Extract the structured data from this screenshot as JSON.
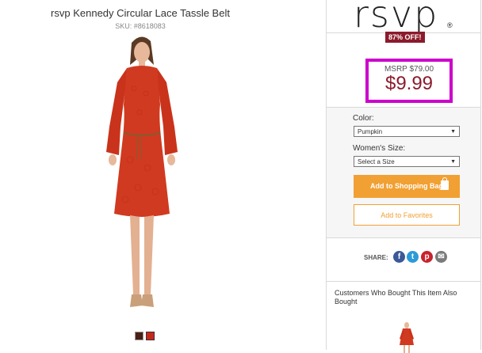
{
  "product": {
    "title": "rsvp Kennedy Circular Lace Tassle Belt",
    "sku": "SKU: #8618083"
  },
  "swatches": [
    {
      "color": "#4a1f14"
    },
    {
      "color": "#c8281c"
    }
  ],
  "brand": {
    "logo_text": "rsvp",
    "registered_mark": "®"
  },
  "pricing": {
    "discount_badge": "87% OFF!",
    "msrp": "MSRP $79.00",
    "price": "$9.99"
  },
  "options": {
    "color_label": "Color:",
    "color_value": "Pumpkin",
    "size_label": "Women's Size:",
    "size_value": "Select a Size"
  },
  "actions": {
    "add_to_bag": "Add to Shopping Bag",
    "add_to_favorites": "Add to Favorites"
  },
  "share": {
    "label": "SHARE:",
    "icons": [
      "facebook-icon",
      "twitter-icon",
      "pinterest-icon",
      "email-icon"
    ]
  },
  "also_bought": {
    "title": "Customers Who Bought This Item Also Bought"
  },
  "colors": {
    "dress": "#d03a20",
    "accent_orange": "#f1a033",
    "price_red": "#8b1b2c",
    "highlight_magenta": "#cc00cc"
  }
}
